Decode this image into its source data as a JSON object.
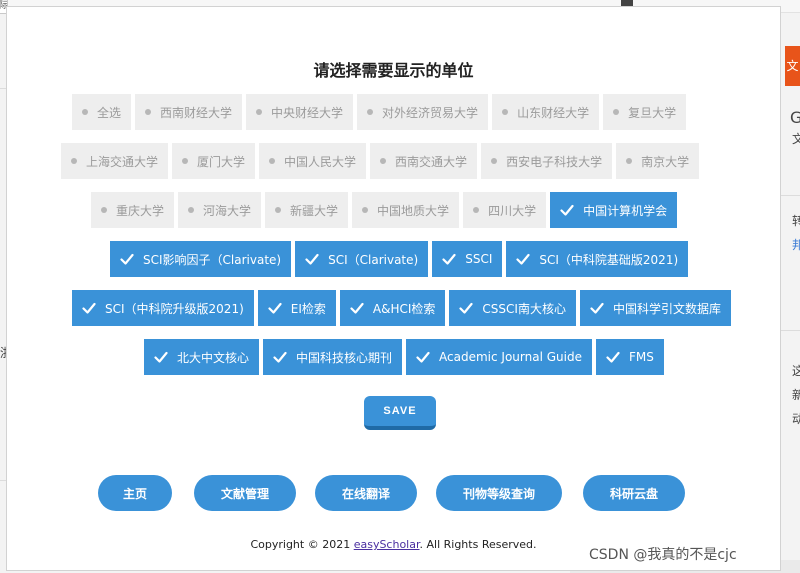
{
  "background": {
    "tab_label": "际",
    "orange_label": "文",
    "fragments": [
      "G",
      "文",
      "转",
      "邦",
      "浙",
      "这",
      "新",
      "动"
    ]
  },
  "dialog": {
    "title": "请选择需要显示的单位",
    "rows": [
      [
        {
          "label": "全选",
          "checked": false
        },
        {
          "label": "西南财经大学",
          "checked": false
        },
        {
          "label": "中央财经大学",
          "checked": false
        },
        {
          "label": "对外经济贸易大学",
          "checked": false
        },
        {
          "label": "山东财经大学",
          "checked": false
        },
        {
          "label": "复旦大学",
          "checked": false
        }
      ],
      [
        {
          "label": "上海交通大学",
          "checked": false
        },
        {
          "label": "厦门大学",
          "checked": false
        },
        {
          "label": "中国人民大学",
          "checked": false
        },
        {
          "label": "西南交通大学",
          "checked": false
        },
        {
          "label": "西安电子科技大学",
          "checked": false
        },
        {
          "label": "南京大学",
          "checked": false
        }
      ],
      [
        {
          "label": "重庆大学",
          "checked": false
        },
        {
          "label": "河海大学",
          "checked": false
        },
        {
          "label": "新疆大学",
          "checked": false
        },
        {
          "label": "中国地质大学",
          "checked": false
        },
        {
          "label": "四川大学",
          "checked": false
        },
        {
          "label": "中国计算机学会",
          "checked": true
        }
      ],
      [
        {
          "label": "SCI影响因子（Clarivate)",
          "checked": true
        },
        {
          "label": "SCI（Clarivate)",
          "checked": true
        },
        {
          "label": "SSCI",
          "checked": true
        },
        {
          "label": "SCI（中科院基础版2021)",
          "checked": true
        }
      ],
      [
        {
          "label": "SCI（中科院升级版2021)",
          "checked": true
        },
        {
          "label": "EI检索",
          "checked": true
        },
        {
          "label": "A&HCI检索",
          "checked": true
        },
        {
          "label": "CSSCI南大核心",
          "checked": true
        },
        {
          "label": "中国科学引文数据库",
          "checked": true
        }
      ],
      [
        {
          "label": "北大中文核心",
          "checked": true
        },
        {
          "label": "中国科技核心期刊",
          "checked": true
        },
        {
          "label": "Academic Journal Guide",
          "checked": true
        },
        {
          "label": "FMS",
          "checked": true
        }
      ]
    ],
    "save_label": "SAVE",
    "nav": [
      "主页",
      "文献管理",
      "在线翻译",
      "刊物等级查询",
      "科研云盘"
    ],
    "footer": {
      "prefix": "Copyright © 2021 ",
      "link": "easyScholar",
      "suffix": ". All Rights Reserved."
    }
  },
  "watermark": "CSDN @我真的不是cjc",
  "colors": {
    "accent": "#3a92d8",
    "accent_dark": "#1f6aa6",
    "unchecked_bg": "#eeeeee",
    "unchecked_text": "#9b9b9b"
  }
}
